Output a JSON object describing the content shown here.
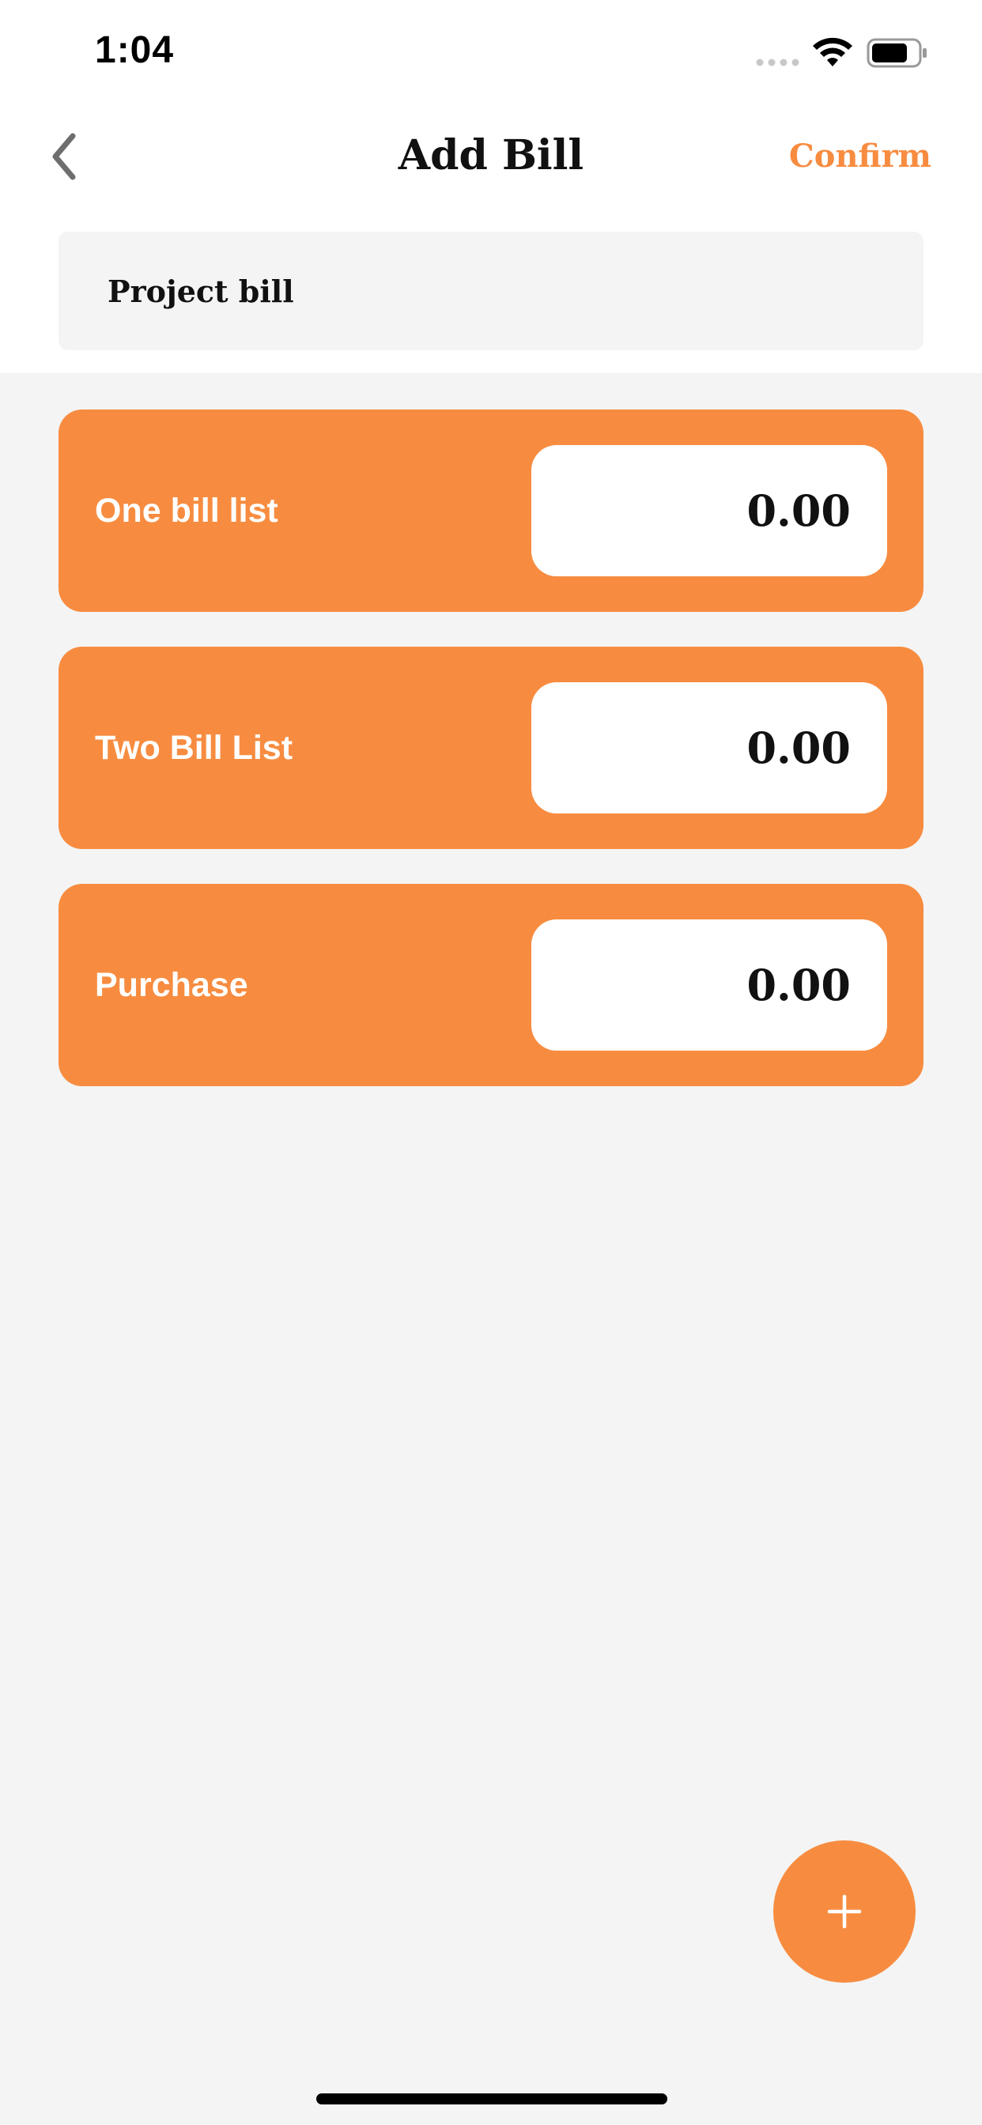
{
  "status_bar": {
    "time": "1:04",
    "icons": [
      "signal-icon",
      "wifi-icon",
      "battery-icon"
    ]
  },
  "nav": {
    "back_icon": "chevron-left-icon",
    "title": "Add Bill",
    "confirm_label": "Confirm"
  },
  "project": {
    "value": "Project bill"
  },
  "bills": [
    {
      "label": "One bill list",
      "amount": "0.00"
    },
    {
      "label": "Two Bill List",
      "amount": "0.00"
    },
    {
      "label": "Purchase",
      "amount": "0.00"
    }
  ],
  "fab": {
    "icon": "plus-icon"
  },
  "colors": {
    "accent": "#f78c40",
    "background": "#f4f4f4",
    "surface": "#ffffff",
    "text": "#111111"
  }
}
